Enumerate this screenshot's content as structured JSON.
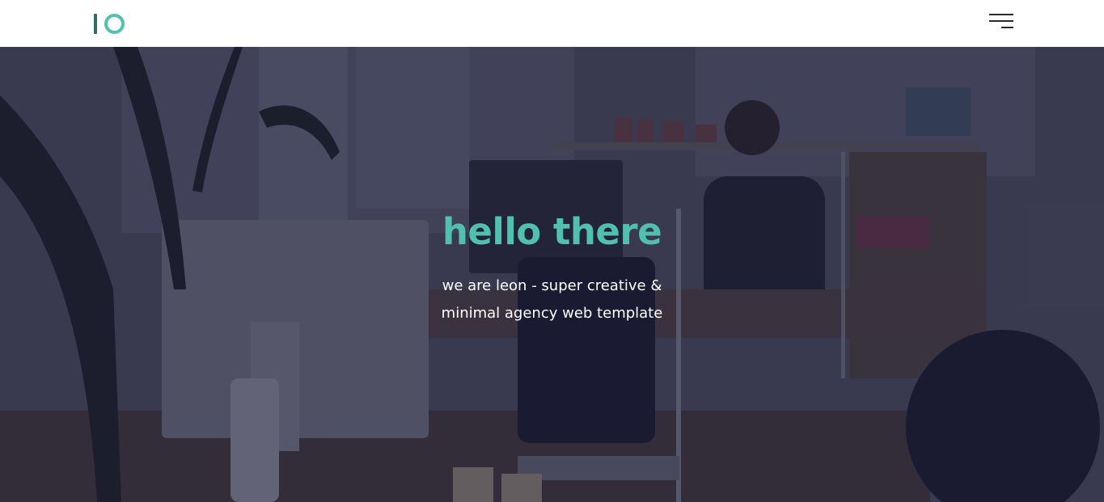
{
  "header": {
    "logo_name": "logo-icon",
    "menu_icon": "hamburger-menu-icon"
  },
  "hero": {
    "title": "hello there",
    "subtitle_line1": "we are leon - super creative &",
    "subtitle_line2": "minimal agency web template"
  },
  "colors": {
    "accent": "#4fc1ae",
    "logo_dark": "#2f6f6a",
    "overlay": "#1f1f38",
    "header_bg": "#ffffff",
    "text_light": "#ffffff"
  }
}
